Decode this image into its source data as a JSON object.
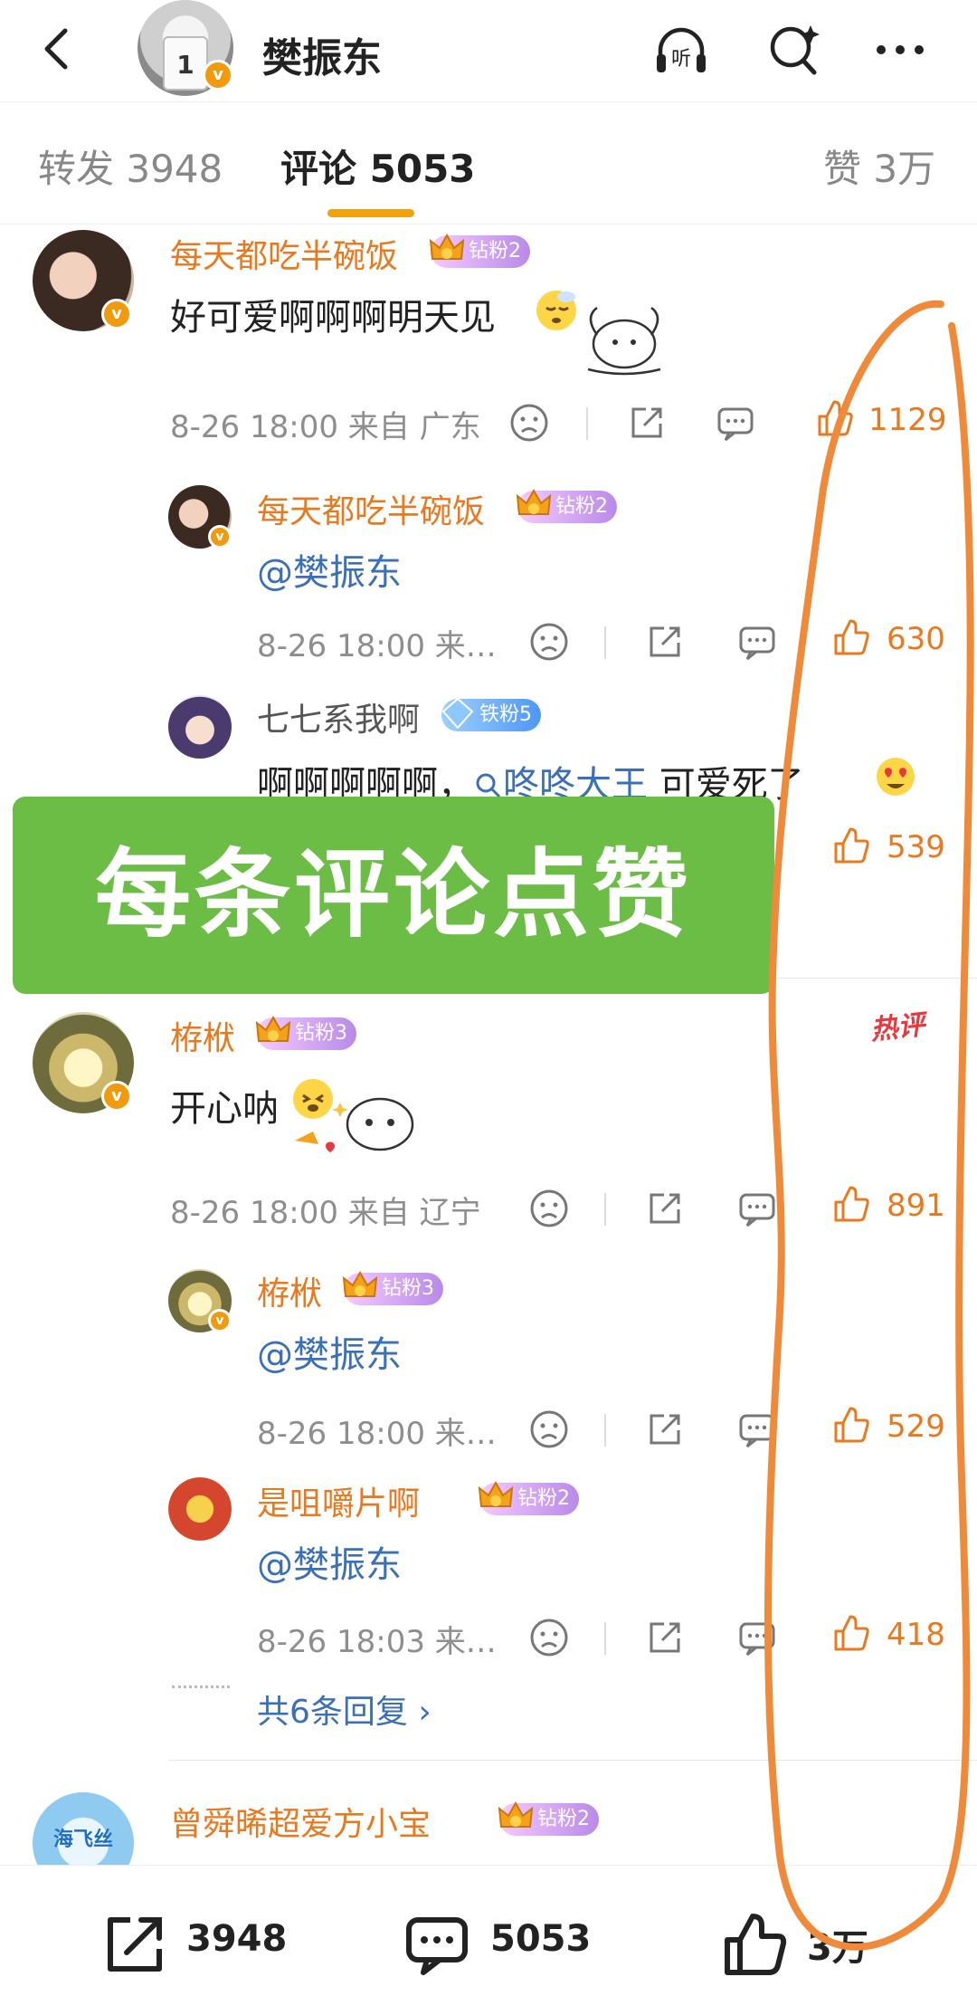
{
  "header": {
    "title": "樊振东",
    "avatar_text": "1",
    "listen_label": "听"
  },
  "tabs": {
    "repost": "转发 3948",
    "comments": "评论 5053",
    "likes": "赞 3万"
  },
  "comments": [
    {
      "user": "每天都吃半碗饭",
      "badge": "钻粉2",
      "text": "好可爱啊啊啊明天见",
      "time": "8-26 18:00 来自 广东",
      "likes": "1129",
      "replies": [
        {
          "user": "每天都吃半碗饭",
          "badge": "钻粉2",
          "text": "@樊振东",
          "time": "8-26 18:00 来…",
          "likes": "630"
        },
        {
          "user": "七七系我啊",
          "badge": "铁粉5",
          "text_before": "啊啊啊啊啊，",
          "mention": "咚咚大王",
          "text_after": " 可爱死了",
          "likes": "539"
        }
      ]
    },
    {
      "user": "栫栿",
      "badge": "钻粉3",
      "hot_label": "热评",
      "text": "开心呐",
      "time": "8-26 18:00 来自 辽宁",
      "likes": "891",
      "replies": [
        {
          "user": "栫栿",
          "badge": "钻粉3",
          "text": "@樊振东",
          "time": "8-26 18:00 来…",
          "likes": "529"
        },
        {
          "user": "是咀嚼片啊",
          "badge": "钻粉2",
          "text": "@樊振东",
          "time": "8-26 18:03 来…",
          "likes": "418"
        }
      ],
      "more_replies": "共6条回复 ›"
    },
    {
      "user": "曾舜晞超爱方小宝",
      "badge": "钻粉2",
      "avatar_text": "海飞丝"
    }
  ],
  "overlay": {
    "text": "每条评论点赞"
  },
  "bottom_bar": {
    "repost_count": "3948",
    "comment_count": "5053",
    "like_count": "3万"
  },
  "colors": {
    "accent": "#e8791f",
    "tab_indicator": "#f5a10d",
    "mention": "#3b6fb6",
    "overlay_green": "#6cbd46",
    "scribble": "#ef8a3a"
  }
}
